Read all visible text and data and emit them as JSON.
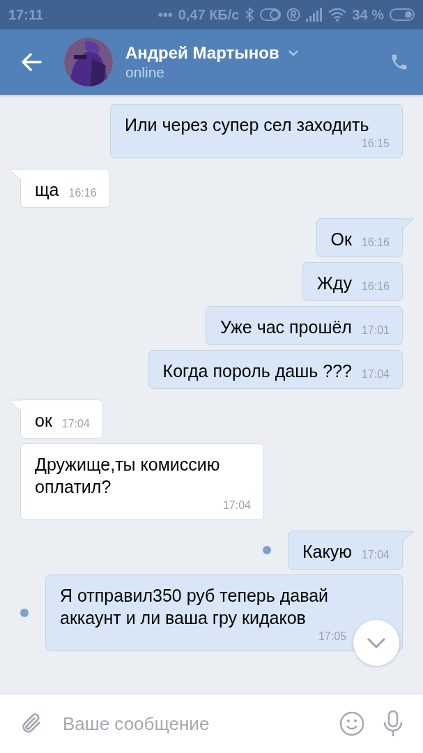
{
  "status_bar": {
    "time": "17:11",
    "dots": "•••",
    "speed": "0,47 КБ/с",
    "battery": "34 %"
  },
  "header": {
    "name": "Андрей Мартынов",
    "status": "online"
  },
  "messages": [
    {
      "kind": "out",
      "text": "Или через супер сел заходить",
      "time": "16:15",
      "tail": false,
      "unread": false
    },
    {
      "kind": "in",
      "text": "ща",
      "time": "16:16",
      "tail": true,
      "unread": false
    },
    {
      "kind": "out",
      "text": "Ок",
      "time": "16:16",
      "tail": true,
      "unread": false
    },
    {
      "kind": "out",
      "text": "Жду",
      "time": "16:16",
      "tail": false,
      "unread": false
    },
    {
      "kind": "out",
      "text": "Уже час прошёл",
      "time": "17:01",
      "tail": false,
      "unread": false
    },
    {
      "kind": "out",
      "text": "Когда пороль дашь ???",
      "time": "17:04",
      "tail": false,
      "unread": false
    },
    {
      "kind": "in",
      "text": "ок",
      "time": "17:04",
      "tail": true,
      "unread": false
    },
    {
      "kind": "in",
      "text": "Дружище,ты комиссию оплатил?",
      "time": "17:04",
      "tail": false,
      "unread": false
    },
    {
      "kind": "out",
      "text": "Какую",
      "time": "17:04",
      "tail": true,
      "unread": true
    },
    {
      "kind": "out",
      "text": "Я отправил350 руб теперь давай аккаунт и ли ваша гру кидаков",
      "time": "17:05",
      "tail": false,
      "unread": true
    }
  ],
  "composer": {
    "placeholder": "Ваше сообщение"
  }
}
